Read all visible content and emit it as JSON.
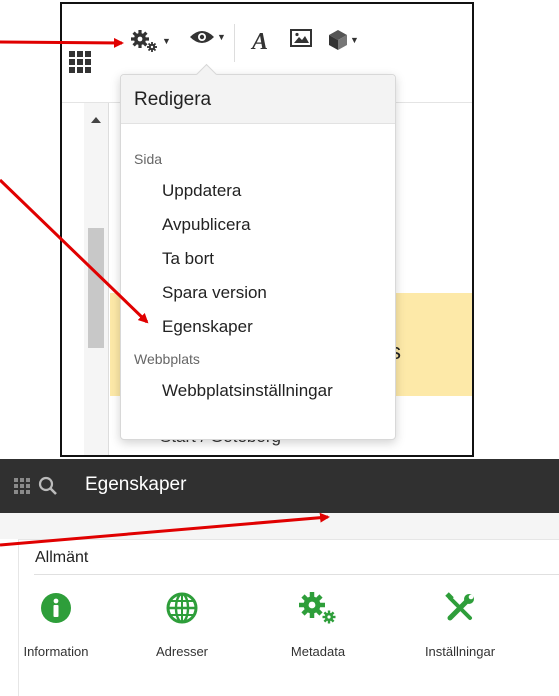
{
  "toolbar": {
    "icons": [
      "grid-icon",
      "gear-icon",
      "eye-icon",
      "font-icon",
      "image-icon",
      "box-icon"
    ]
  },
  "dropdown": {
    "title": "Redigera",
    "section_page": "Sida",
    "items_page": [
      "Uppdatera",
      "Avpublicera",
      "Ta bort",
      "Spara version",
      "Egenskaper"
    ],
    "section_site": "Webbplats",
    "items_site": [
      "Webbplatsinställningar"
    ]
  },
  "background": {
    "page_letter": "s",
    "breadcrumb": "Start  /  Göteborg"
  },
  "bottom": {
    "title": "Egenskaper",
    "panel_heading": "Allmänt",
    "tiles": [
      "Information",
      "Adresser",
      "Metadata",
      "Inställningar"
    ]
  },
  "colors": {
    "annotation_arrow": "#e00000",
    "tile_icon_green": "#2e9e3a",
    "dark_bar": "#303030",
    "highlight_yellow": "#fde9a8"
  }
}
